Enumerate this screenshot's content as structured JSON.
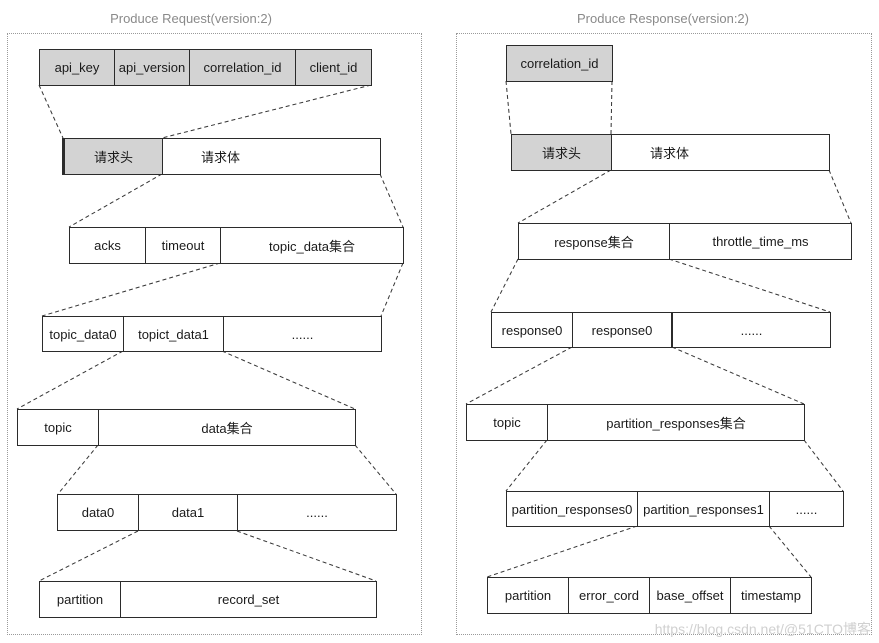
{
  "request": {
    "title": "Produce Request(version:2)",
    "header_fields": [
      "api_key",
      "api_version",
      "correlation_id",
      "client_id"
    ],
    "request_parts": [
      "请求头",
      "请求体"
    ],
    "body_fields": [
      "acks",
      "timeout",
      "topic_data集合"
    ],
    "topic_data_items": [
      "topic_data0",
      "topict_data1",
      "......"
    ],
    "topic_data_fields": [
      "topic",
      "data集合"
    ],
    "data_items": [
      "data0",
      "data1",
      "......"
    ],
    "data_fields": [
      "partition",
      "record_set"
    ]
  },
  "response": {
    "title": "Produce Response(version:2)",
    "header_fields": [
      "correlation_id"
    ],
    "response_parts": [
      "请求头",
      "请求体"
    ],
    "body_fields": [
      "response集合",
      "throttle_time_ms"
    ],
    "response_items": [
      "response0",
      "response0",
      "......"
    ],
    "response_fields": [
      "topic",
      "partition_responses集合"
    ],
    "partition_response_items": [
      "partition_responses0",
      "partition_responses1",
      "......"
    ],
    "partition_response_fields": [
      "partition",
      "error_cord",
      "base_offset",
      "timestamp"
    ]
  },
  "watermark": "https://blog.csdn.net/@51CTO博客"
}
